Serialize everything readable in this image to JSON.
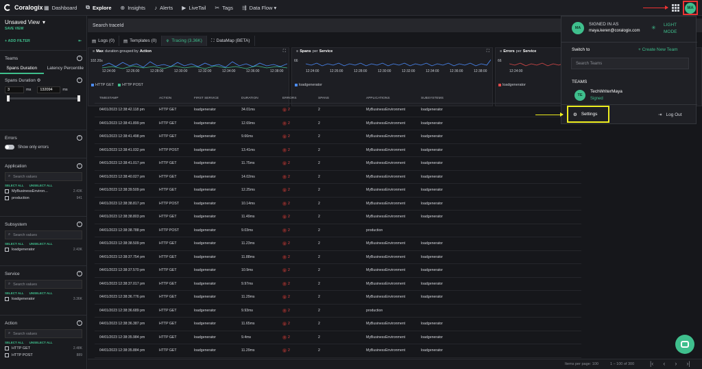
{
  "topbar": {
    "brand": "Coralogix",
    "nav": [
      {
        "label": "Dashboard",
        "icon": "dashboard-icon"
      },
      {
        "label": "Explore",
        "icon": "explore-icon"
      },
      {
        "label": "Insights",
        "icon": "insights-icon"
      },
      {
        "label": "Alerts",
        "icon": "bell-icon"
      },
      {
        "label": "LiveTail",
        "icon": "play-icon"
      },
      {
        "label": "Tags",
        "icon": "tag-icon"
      },
      {
        "label": "Data Flow ▾",
        "icon": "dataflow-icon"
      }
    ],
    "avatar": "MA"
  },
  "sidebar": {
    "view_title": "Unsaved View",
    "save_view": "SAVE VIEW",
    "add_filter": "ADD FILTER",
    "teams_label": "Teams",
    "tabs": [
      "Spans Duration",
      "Latency Percentile"
    ],
    "spans_duration_label": "Spans Duration",
    "range_min": "3",
    "range_unit": "ms",
    "range_max": "132094",
    "errors_label": "Errors",
    "show_only_errors": "Show only errors",
    "search_placeholder": "Search values",
    "select_all": "SELECT ALL",
    "unselect_all": "UNSELECT ALL",
    "application": {
      "label": "Application",
      "items": [
        {
          "name": "MyBusinessEnviron...",
          "count": "2.43K"
        },
        {
          "name": "production",
          "count": "941"
        }
      ]
    },
    "subsystem": {
      "label": "Subsystem",
      "items": [
        {
          "name": "loadgenerator",
          "count": "2.43K"
        }
      ]
    },
    "service": {
      "label": "Service",
      "items": [
        {
          "name": "loadgenerator",
          "count": "3.36K"
        }
      ]
    },
    "action": {
      "label": "Action",
      "items": [
        {
          "name": "HTTP GET",
          "count": "2.48K"
        },
        {
          "name": "HTTP POST",
          "count": "889"
        }
      ]
    }
  },
  "main": {
    "search_placeholder": "Search traceId",
    "tabs": [
      "Logs (0)",
      "Templates (0)",
      "Tracing (3.36K)",
      "DataMap (BETA)"
    ],
    "charts": [
      {
        "pre": "Max",
        "mid": "duration grouped by",
        "post": "Action",
        "ytop": "102.20s",
        "xticks": [
          "12:24:00",
          "12:26:00",
          "12:28:00",
          "12:30:00",
          "12:32:00",
          "12:34:00",
          "12:36:00",
          "12:38:00"
        ],
        "legend": [
          {
            "name": "HTTP GET",
            "color": "#4c8dff"
          },
          {
            "name": "HTTP POST",
            "color": "#3fbf8d"
          }
        ]
      },
      {
        "pre": "Spans",
        "mid": "per",
        "post": "Service",
        "ytop": "66",
        "xticks": [
          "12:24:00",
          "12:26:00",
          "12:28:00",
          "12:30:00",
          "12:32:00",
          "12:34:00",
          "12:36:00",
          "12:38:00"
        ],
        "legend": [
          {
            "name": "loadgenerator",
            "color": "#4c8dff"
          }
        ]
      },
      {
        "pre": "Errors",
        "mid": "per",
        "post": "Service",
        "ytop": "66",
        "xticks": [
          "12:24:00"
        ],
        "legend": [
          {
            "name": "loadgenerator",
            "color": "#e04a4a"
          }
        ]
      }
    ],
    "columns": [
      "TIMESTAMP",
      "ACTION",
      "FIRST SERVICE",
      "DURATION",
      "ERRORS",
      "SPANS",
      "APPLICATIONS",
      "SUBSYSTEMS"
    ],
    "rows": [
      [
        "04/01/2023 12:38:42.118 pm",
        "HTTP GET",
        "loadgenerator",
        "34.01ms",
        "2",
        "2",
        "MyBusinessEnvironment",
        "loadgenerator"
      ],
      [
        "04/01/2023 12:38:41.899 pm",
        "HTTP GET",
        "loadgenerator",
        "12.69ms",
        "2",
        "2",
        "MyBusinessEnvironment",
        "loadgenerator"
      ],
      [
        "04/01/2023 12:38:41.498 pm",
        "HTTP GET",
        "loadgenerator",
        "9.66ms",
        "2",
        "2",
        "MyBusinessEnvironment",
        "loadgenerator"
      ],
      [
        "04/01/2023 12:38:41.032 pm",
        "HTTP POST",
        "loadgenerator",
        "13.41ms",
        "2",
        "2",
        "MyBusinessEnvironment",
        "loadgenerator"
      ],
      [
        "04/01/2023 12:38:41.017 pm",
        "HTTP GET",
        "loadgenerator",
        "11.75ms",
        "2",
        "2",
        "MyBusinessEnvironment",
        "loadgenerator"
      ],
      [
        "04/01/2023 12:38:40.027 pm",
        "HTTP GET",
        "loadgenerator",
        "14.02ms",
        "2",
        "2",
        "MyBusinessEnvironment",
        "loadgenerator"
      ],
      [
        "04/01/2023 12:38:39.509 pm",
        "HTTP GET",
        "loadgenerator",
        "12.25ms",
        "2",
        "2",
        "MyBusinessEnvironment",
        "loadgenerator"
      ],
      [
        "04/01/2023 12:38:38.817 pm",
        "HTTP POST",
        "loadgenerator",
        "10.14ms",
        "2",
        "2",
        "MyBusinessEnvironment",
        "loadgenerator"
      ],
      [
        "04/01/2023 12:38:38.803 pm",
        "HTTP GET",
        "loadgenerator",
        "11.49ms",
        "2",
        "2",
        "MyBusinessEnvironment",
        "loadgenerator"
      ],
      [
        "04/01/2023 12:38:38.788 pm",
        "HTTP POST",
        "loadgenerator",
        "9.03ms",
        "2",
        "2",
        "production",
        ""
      ],
      [
        "04/01/2023 12:38:38.509 pm",
        "HTTP GET",
        "loadgenerator",
        "11.23ms",
        "2",
        "2",
        "MyBusinessEnvironment",
        "loadgenerator"
      ],
      [
        "04/01/2023 12:38:37.754 pm",
        "HTTP GET",
        "loadgenerator",
        "11.88ms",
        "2",
        "2",
        "MyBusinessEnvironment",
        "loadgenerator"
      ],
      [
        "04/01/2023 12:38:37.570 pm",
        "HTTP GET",
        "loadgenerator",
        "10.9ms",
        "2",
        "2",
        "MyBusinessEnvironment",
        "loadgenerator"
      ],
      [
        "04/01/2023 12:38:37.017 pm",
        "HTTP GET",
        "loadgenerator",
        "9.97ms",
        "2",
        "2",
        "MyBusinessEnvironment",
        "loadgenerator"
      ],
      [
        "04/01/2023 12:38:36.776 pm",
        "HTTP GET",
        "loadgenerator",
        "11.29ms",
        "2",
        "2",
        "MyBusinessEnvironment",
        "loadgenerator"
      ],
      [
        "04/01/2023 12:38:36.689 pm",
        "HTTP GET",
        "loadgenerator",
        "9.93ms",
        "2",
        "2",
        "production",
        ""
      ],
      [
        "04/01/2023 12:38:36.387 pm",
        "HTTP GET",
        "loadgenerator",
        "11.65ms",
        "2",
        "2",
        "MyBusinessEnvironment",
        "loadgenerator"
      ],
      [
        "04/01/2023 12:38:35.984 pm",
        "HTTP GET",
        "loadgenerator",
        "9.4ms",
        "2",
        "2",
        "MyBusinessEnvironment",
        "loadgenerator"
      ],
      [
        "04/01/2023 12:38:35.884 pm",
        "HTTP GET",
        "loadgenerator",
        "11.29ms",
        "2",
        "2",
        "MyBusinessEnvironment",
        "loadgenerator"
      ]
    ],
    "footer": {
      "items_per_page": "Items per page: 100",
      "range": "1 – 100 of 300"
    }
  },
  "popup": {
    "avatar": "MA",
    "signed_in_as": "SIGNED IN AS",
    "email": "maya.keren@coralogix.com",
    "light_mode": "LIGHT MODE",
    "switch_to": "Switch to",
    "create_team": "+ Create New Team",
    "search_teams": "Search Teams",
    "teams": "TEAMS",
    "team_avatar": "TE",
    "team_name": "TechWriterMaya",
    "team_status": "Signed",
    "settings": "Settings",
    "logout": "Log Out"
  },
  "colors": {
    "accent": "#3fbf8d",
    "highlight": "#f0f020",
    "annotation_red": "#e33"
  }
}
